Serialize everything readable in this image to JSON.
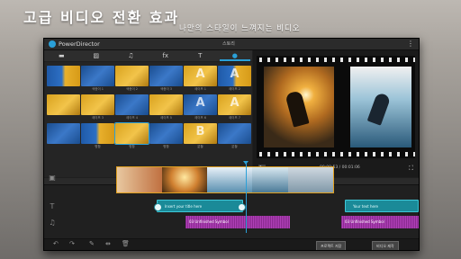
{
  "promo": {
    "headline": "고급 비디오 전환 효과",
    "subline": "나만의 스타일이 느껴지는 비디오"
  },
  "app": {
    "title": "PowerDirector",
    "center_label": "스토리",
    "menu_glyph": "⋮"
  },
  "tabs": [
    {
      "icon": "video-icon",
      "glyph": "▬"
    },
    {
      "icon": "image-icon",
      "glyph": "▨"
    },
    {
      "icon": "music-icon",
      "glyph": "♫"
    },
    {
      "icon": "fx-icon",
      "glyph": "fx"
    },
    {
      "icon": "title-icon",
      "glyph": "T"
    },
    {
      "icon": "transition-icon",
      "glyph": "●"
    }
  ],
  "library": {
    "row1": [
      "",
      "색종이 1",
      "색종이 2",
      "색종이 3",
      "셰이프 1",
      "셰이프 2"
    ],
    "row2": [
      "",
      "셰이프 3",
      "셰이프 4",
      "셰이프 5",
      "셰이프 6",
      "셰이프 7"
    ],
    "row3": [
      "",
      "병합",
      "병합",
      "병합",
      "분할",
      "분할"
    ]
  },
  "preview": {
    "timecode": "00:00:53 / 00:01:06"
  },
  "ruler": [
    "00:00:00",
    "00:00:30",
    "00:01:00",
    "00:01:30"
  ],
  "timeline": {
    "title_clip_left": "Insert your title here",
    "title_clip_right": "Your text here",
    "audio_clip_left": "03 Unfinished Symbol",
    "audio_clip_right": "03 Unfinished Symbol"
  },
  "toolbar": {
    "btn_produce": "프로젝트 저장",
    "btn_export": "비디오 제작"
  }
}
